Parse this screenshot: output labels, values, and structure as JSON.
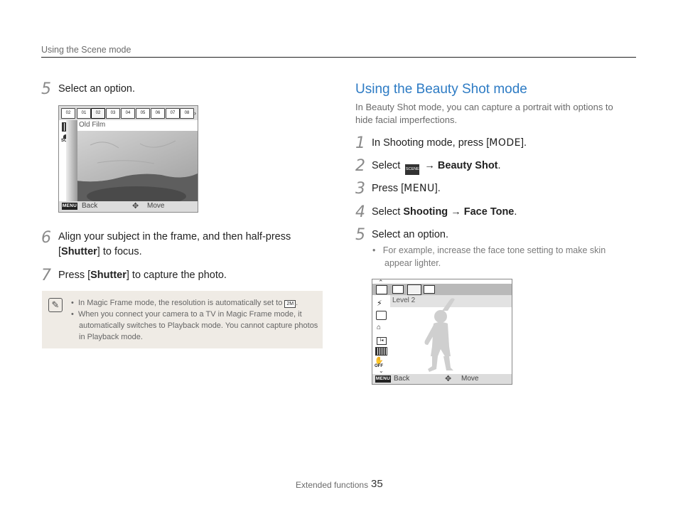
{
  "header": {
    "section": "Using the Scene mode"
  },
  "left": {
    "step5": {
      "num": "5",
      "text": "Select an option."
    },
    "screen1": {
      "mode_label": "Old Film",
      "back_label": "Back",
      "move_label": "Move",
      "menu_label": "MENU",
      "icons": [
        "01",
        "02",
        "03",
        "04",
        "05",
        "06",
        "07",
        "08"
      ],
      "first_icon": "02",
      "left_icon_1": "SOFF"
    },
    "step6": {
      "num": "6",
      "text_a": "Align your subject in the frame, and then half-press",
      "bracket_open": "[",
      "shutter": "Shutter",
      "text_b": "] to focus."
    },
    "step7": {
      "num": "7",
      "text_a": "Press [",
      "shutter": "Shutter",
      "text_b": "] to capture the photo."
    },
    "note": {
      "bullet1": "In Magic Frame mode, the resolution is automatically set to",
      "bullet1_icon": "2M",
      "bullet1_end": ".",
      "bullet2_line1": "When you connect your camera to a TV in Magic Frame mode, it",
      "bullet2_line2": "automatically switches to Playback mode. You cannot capture photos",
      "bullet2_line3": "in Playback mode."
    }
  },
  "right": {
    "title": "Using the Beauty Shot mode",
    "intro_line1": "In Beauty Shot mode, you can capture a portrait with options to",
    "intro_line2": "hide facial imperfections.",
    "step1": {
      "num": "1",
      "text_a": "In Shooting mode, press [",
      "key": "MODE",
      "text_b": "]."
    },
    "step2": {
      "num": "2",
      "text_a": "Select",
      "icon": "SCENE",
      "arrow": "→",
      "target": "Beauty Shot",
      "end": "."
    },
    "step3": {
      "num": "3",
      "text_a": "Press [",
      "key": "MENU",
      "text_b": "]."
    },
    "step4": {
      "num": "4",
      "text_a": "Select",
      "item1": "Shooting",
      "arrow": "→",
      "item2": "Face Tone",
      "end": "."
    },
    "step5": {
      "num": "5",
      "text": "Select an option."
    },
    "sub_bullet_line1": "For example, increase the face tone setting to make skin",
    "sub_bullet_line2": "appear lighter.",
    "screen2": {
      "level_label": "Level 2",
      "back_label": "Back",
      "move_label": "Move",
      "menu_label": "MENU",
      "left_icon": "OFF"
    }
  },
  "footer": {
    "label": "Extended functions",
    "page": "35"
  }
}
